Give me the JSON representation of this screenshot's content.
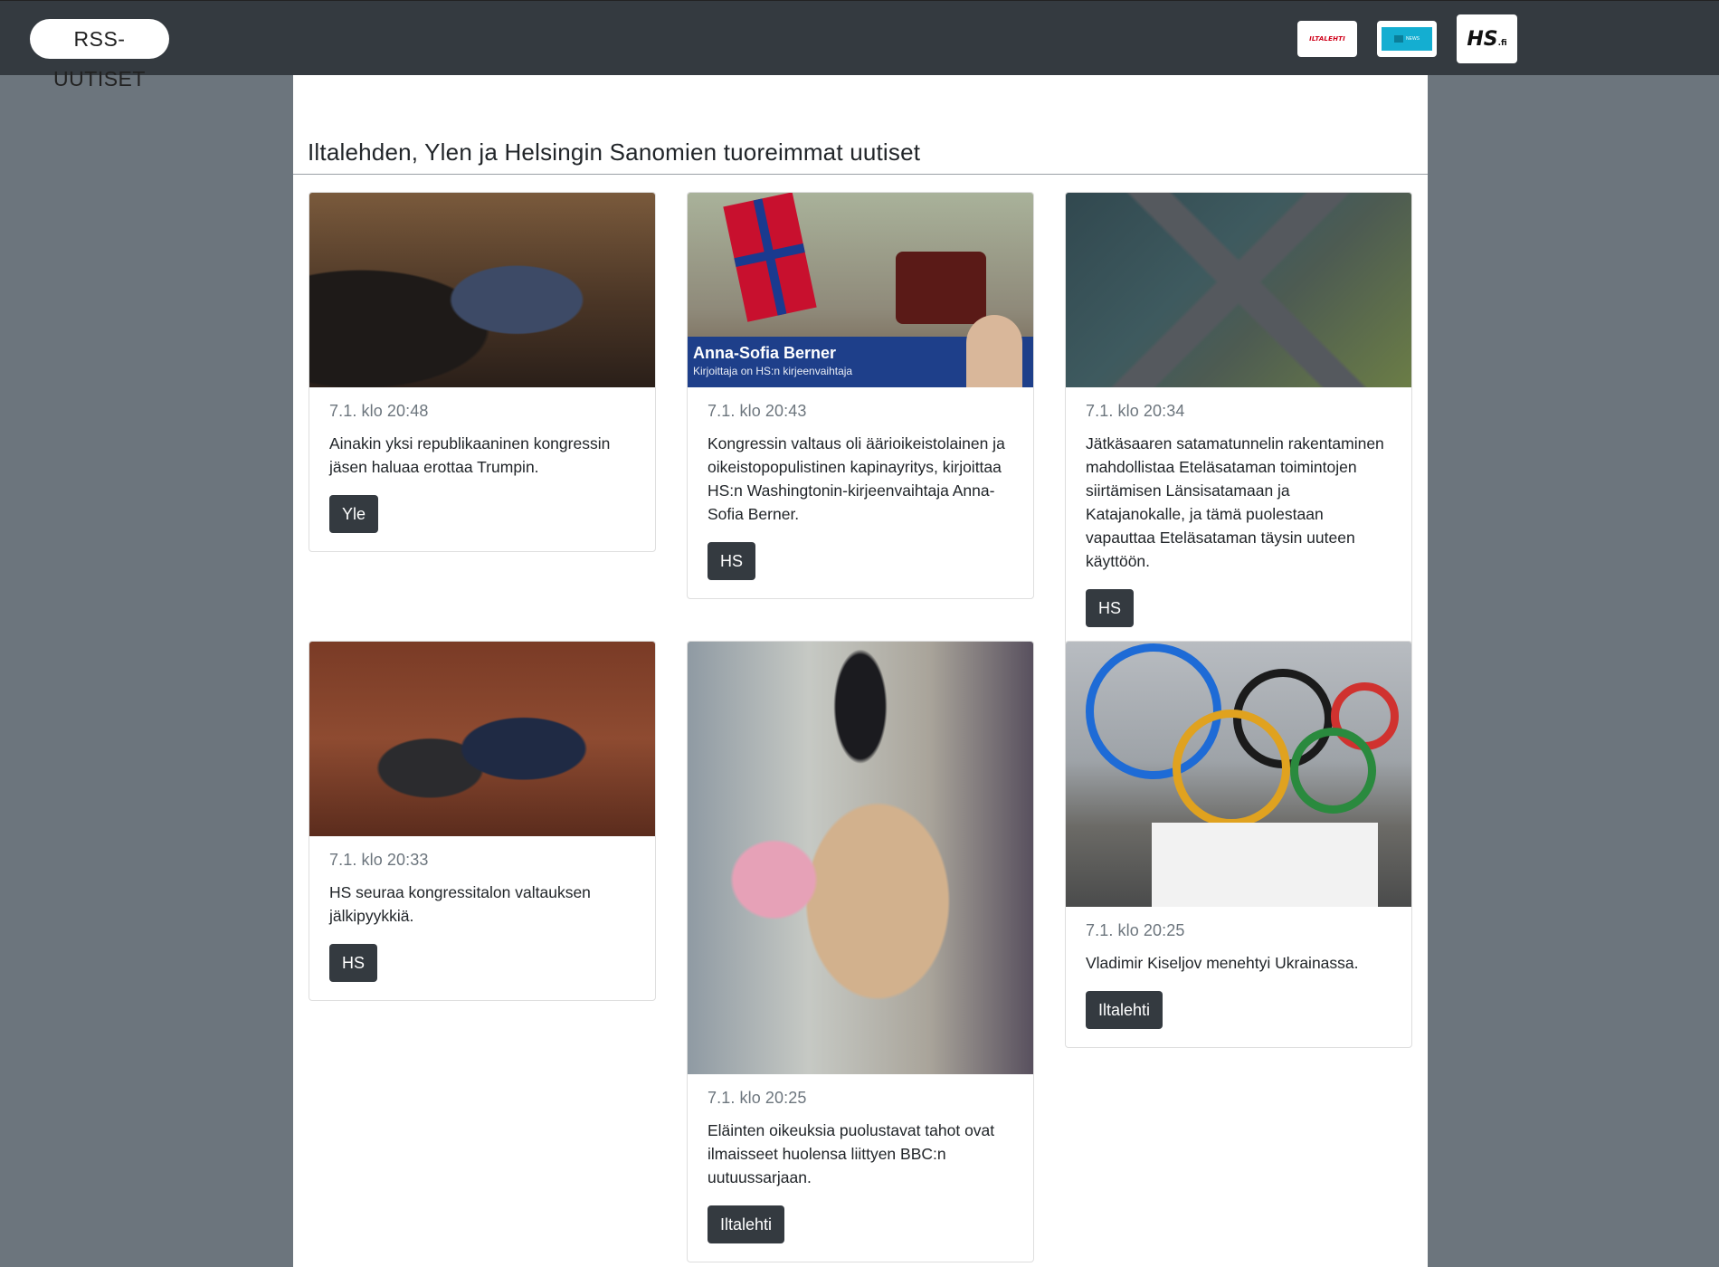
{
  "navbar": {
    "brand": "RSS-UUTISET",
    "logos": [
      {
        "name": "iltalehti-logo",
        "text": "ILTALEHTI"
      },
      {
        "name": "yle-news-logo",
        "text": "NEWS"
      },
      {
        "name": "hs-logo",
        "text": "HS",
        "suffix": ".fi"
      }
    ]
  },
  "page": {
    "title": "Iltalehden, Ylen ja Helsingin Sanomien tuoreimmat uutiset"
  },
  "cards": [
    {
      "time": "7.1. klo 20:48",
      "text": "Ainakin yksi republikaaninen kongressin jäsen haluaa erottaa Trumpin.",
      "source": "Yle"
    },
    {
      "time": "7.1. klo 20:43",
      "text": "Kongressin valtaus oli äärioikeistolainen ja oikeistopopulistinen kapinayritys, kirjoittaa HS:n Washingtonin-kirjeenvaihtaja Anna-Sofia Berner.",
      "source": "HS",
      "image_banner": {
        "name": "Anna-Sofia Berner",
        "role": "Kirjoittaja on HS:n kirjeenvaihtaja"
      }
    },
    {
      "time": "7.1. klo 20:34",
      "text": "Jätkäsaaren satamatunnelin rakentaminen mahdollistaa Eteläsataman toimintojen siirtämisen Länsisatamaan ja Katajanokalle, ja tämä puolestaan vapauttaa Eteläsataman täysin uuteen käyttöön.",
      "source": "HS"
    },
    {
      "time": "7.1. klo 20:33",
      "text": "HS seuraa kongressitalon valtauksen jälkipyykkiä.",
      "source": "HS"
    },
    {
      "time": "7.1. klo 20:25",
      "text": "Eläinten oikeuksia puolustavat tahot ovat ilmaisseet huolensa liittyen BBC:n uutuussarjaan.",
      "source": "Iltalehti"
    },
    {
      "time": "7.1. klo 20:25",
      "text": "Vladimir Kiseljov menehtyi Ukrainassa.",
      "source": "Iltalehti"
    }
  ],
  "colors": {
    "navbar": "#343a40",
    "background": "#6c757d",
    "button": "#343a40"
  }
}
